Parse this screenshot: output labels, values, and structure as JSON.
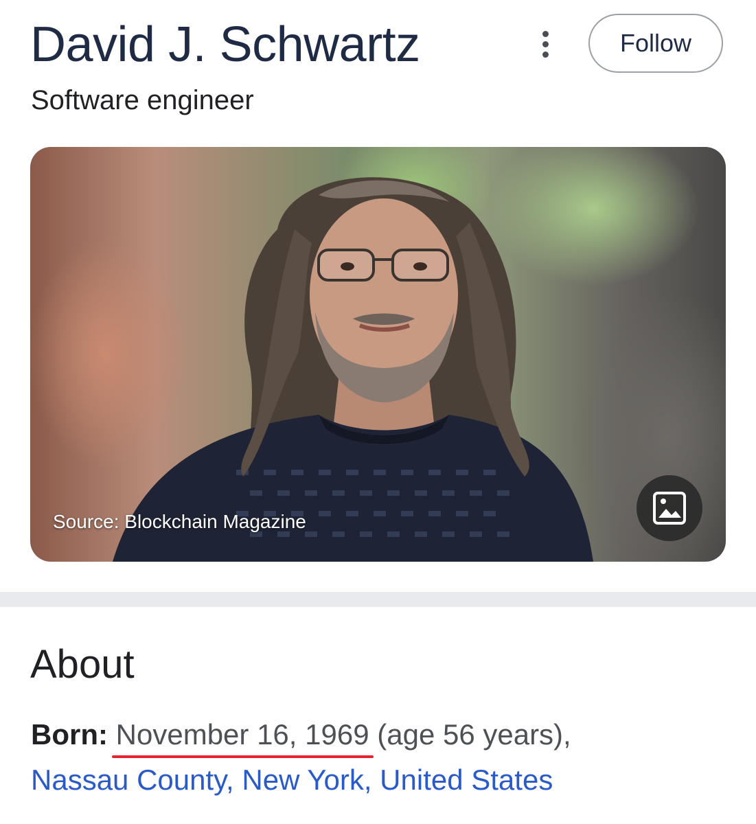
{
  "header": {
    "name": "David J. Schwartz",
    "follow_label": "Follow",
    "more_icon": "more-vert-icon"
  },
  "subtitle": "Software engineer",
  "photo": {
    "source_label": "Source: Blockchain Magazine",
    "image_icon": "image-icon"
  },
  "about": {
    "title": "About",
    "born_label": "Born:",
    "birth_date": "November 16, 1969",
    "age_text": "(age 56 years),",
    "places": [
      "Nassau County",
      "New York",
      "United States"
    ],
    "link_color": "#2a59c8",
    "highlight_color": "#e8232d"
  }
}
